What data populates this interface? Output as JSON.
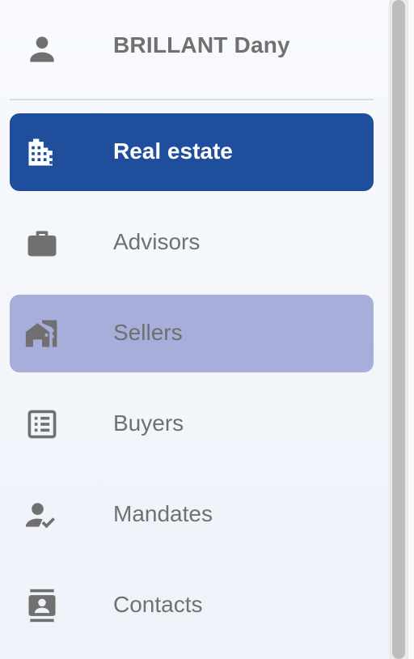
{
  "user": {
    "name": "BRILLANT Dany",
    "icon": "person-icon"
  },
  "colors": {
    "active_bg": "#1f4e9c",
    "hover_bg": "#a7aed9",
    "icon_gray": "#707070"
  },
  "nav": {
    "items": [
      {
        "label": "Real estate",
        "icon": "building-icon",
        "state": "active"
      },
      {
        "label": "Advisors",
        "icon": "briefcase-icon",
        "state": "normal"
      },
      {
        "label": "Sellers",
        "icon": "house-icon",
        "state": "hover"
      },
      {
        "label": "Buyers",
        "icon": "list-icon",
        "state": "normal"
      },
      {
        "label": "Mandates",
        "icon": "person-check-icon",
        "state": "normal"
      },
      {
        "label": "Contacts",
        "icon": "contacts-icon",
        "state": "normal"
      }
    ]
  }
}
